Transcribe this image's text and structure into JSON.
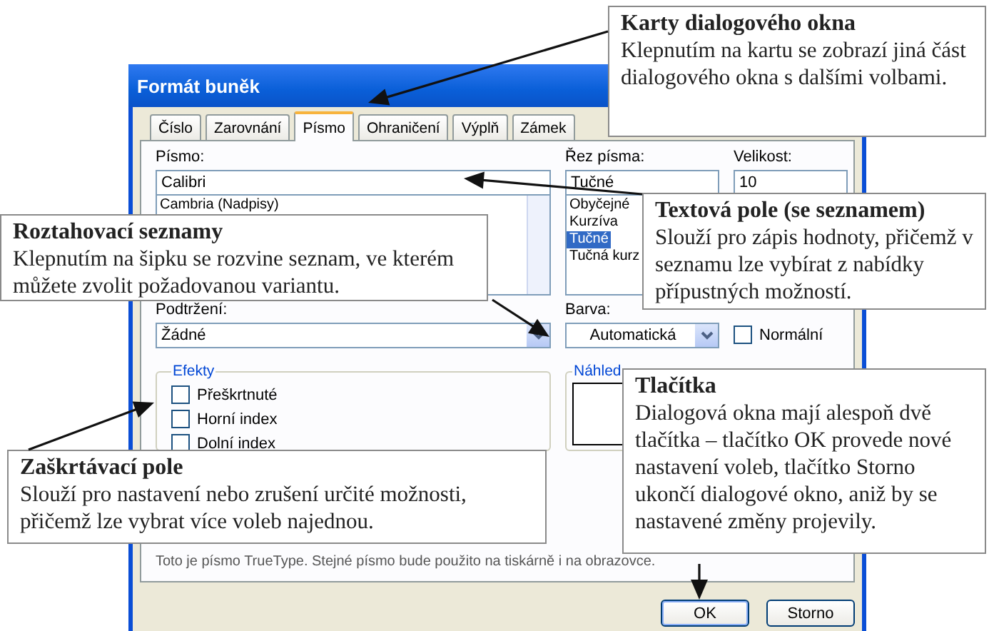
{
  "window": {
    "title": "Formát buněk"
  },
  "tabs": [
    {
      "label": "Číslo",
      "selected": false
    },
    {
      "label": "Zarovnání",
      "selected": false
    },
    {
      "label": "Písmo",
      "selected": true
    },
    {
      "label": "Ohraničení",
      "selected": false
    },
    {
      "label": "Výplň",
      "selected": false
    },
    {
      "label": "Zámek",
      "selected": false
    }
  ],
  "font": {
    "label": "Písmo:",
    "value": "Calibri",
    "options": [
      {
        "label": "Cambria (Nadpisy)",
        "selected": false
      }
    ]
  },
  "style": {
    "label": "Řez písma:",
    "value": "Tučné",
    "options": [
      {
        "label": "Obyčejné",
        "selected": false
      },
      {
        "label": "Kurzíva",
        "selected": false
      },
      {
        "label": "Tučné",
        "selected": true
      },
      {
        "label": "Tučná kurz",
        "selected": false
      }
    ]
  },
  "size": {
    "label": "Velikost:",
    "value": "10"
  },
  "underline": {
    "label": "Podtržení:",
    "value": "Žádné"
  },
  "color": {
    "label": "Barva:",
    "value": "Automatická"
  },
  "normal_font": {
    "label": "Normální",
    "checked": false
  },
  "effects": {
    "title": "Efekty",
    "items": [
      {
        "label": "Přeškrtnuté",
        "checked": false
      },
      {
        "label": "Horní index",
        "checked": false
      },
      {
        "label": "Dolní index",
        "checked": false
      }
    ]
  },
  "preview": {
    "title": "Náhled"
  },
  "hint": "Toto je písmo TrueType. Stejné písmo bude použito na tiskárně i na obrazovce.",
  "buttons": [
    {
      "label": "OK",
      "default": true
    },
    {
      "label": "Storno",
      "default": false
    }
  ],
  "callouts": [
    {
      "title": "Karty dialogového okna",
      "text": "Klepnutím na kartu se zobrazí jiná část dialogového okna s dalšími volbami."
    },
    {
      "title": "Roztahovací seznamy",
      "text": "Klepnutím na šipku se rozvine seznam, ve kterém můžete zvolit požadovanou variantu."
    },
    {
      "title": "Textová pole (se seznamem)",
      "text": "Slouží pro zápis hodnoty, přičemž v seznamu lze vybírat z nabídky přípustných možností."
    }
  ],
  "lower_callouts": [
    {
      "title": "Zaškrtávací pole",
      "text": "Slouží pro nastavení nebo zrušení určité možnosti, přičemž lze vybrat více voleb najednou."
    },
    {
      "title": "Tlačítka",
      "text": "Dialogová okna mají alespoň dvě tlačítka – tlačítko OK provede nové nastavení voleb, tlačítko Storno ukončí dialogové okno, aniž by se nastavené změny projevily."
    }
  ]
}
